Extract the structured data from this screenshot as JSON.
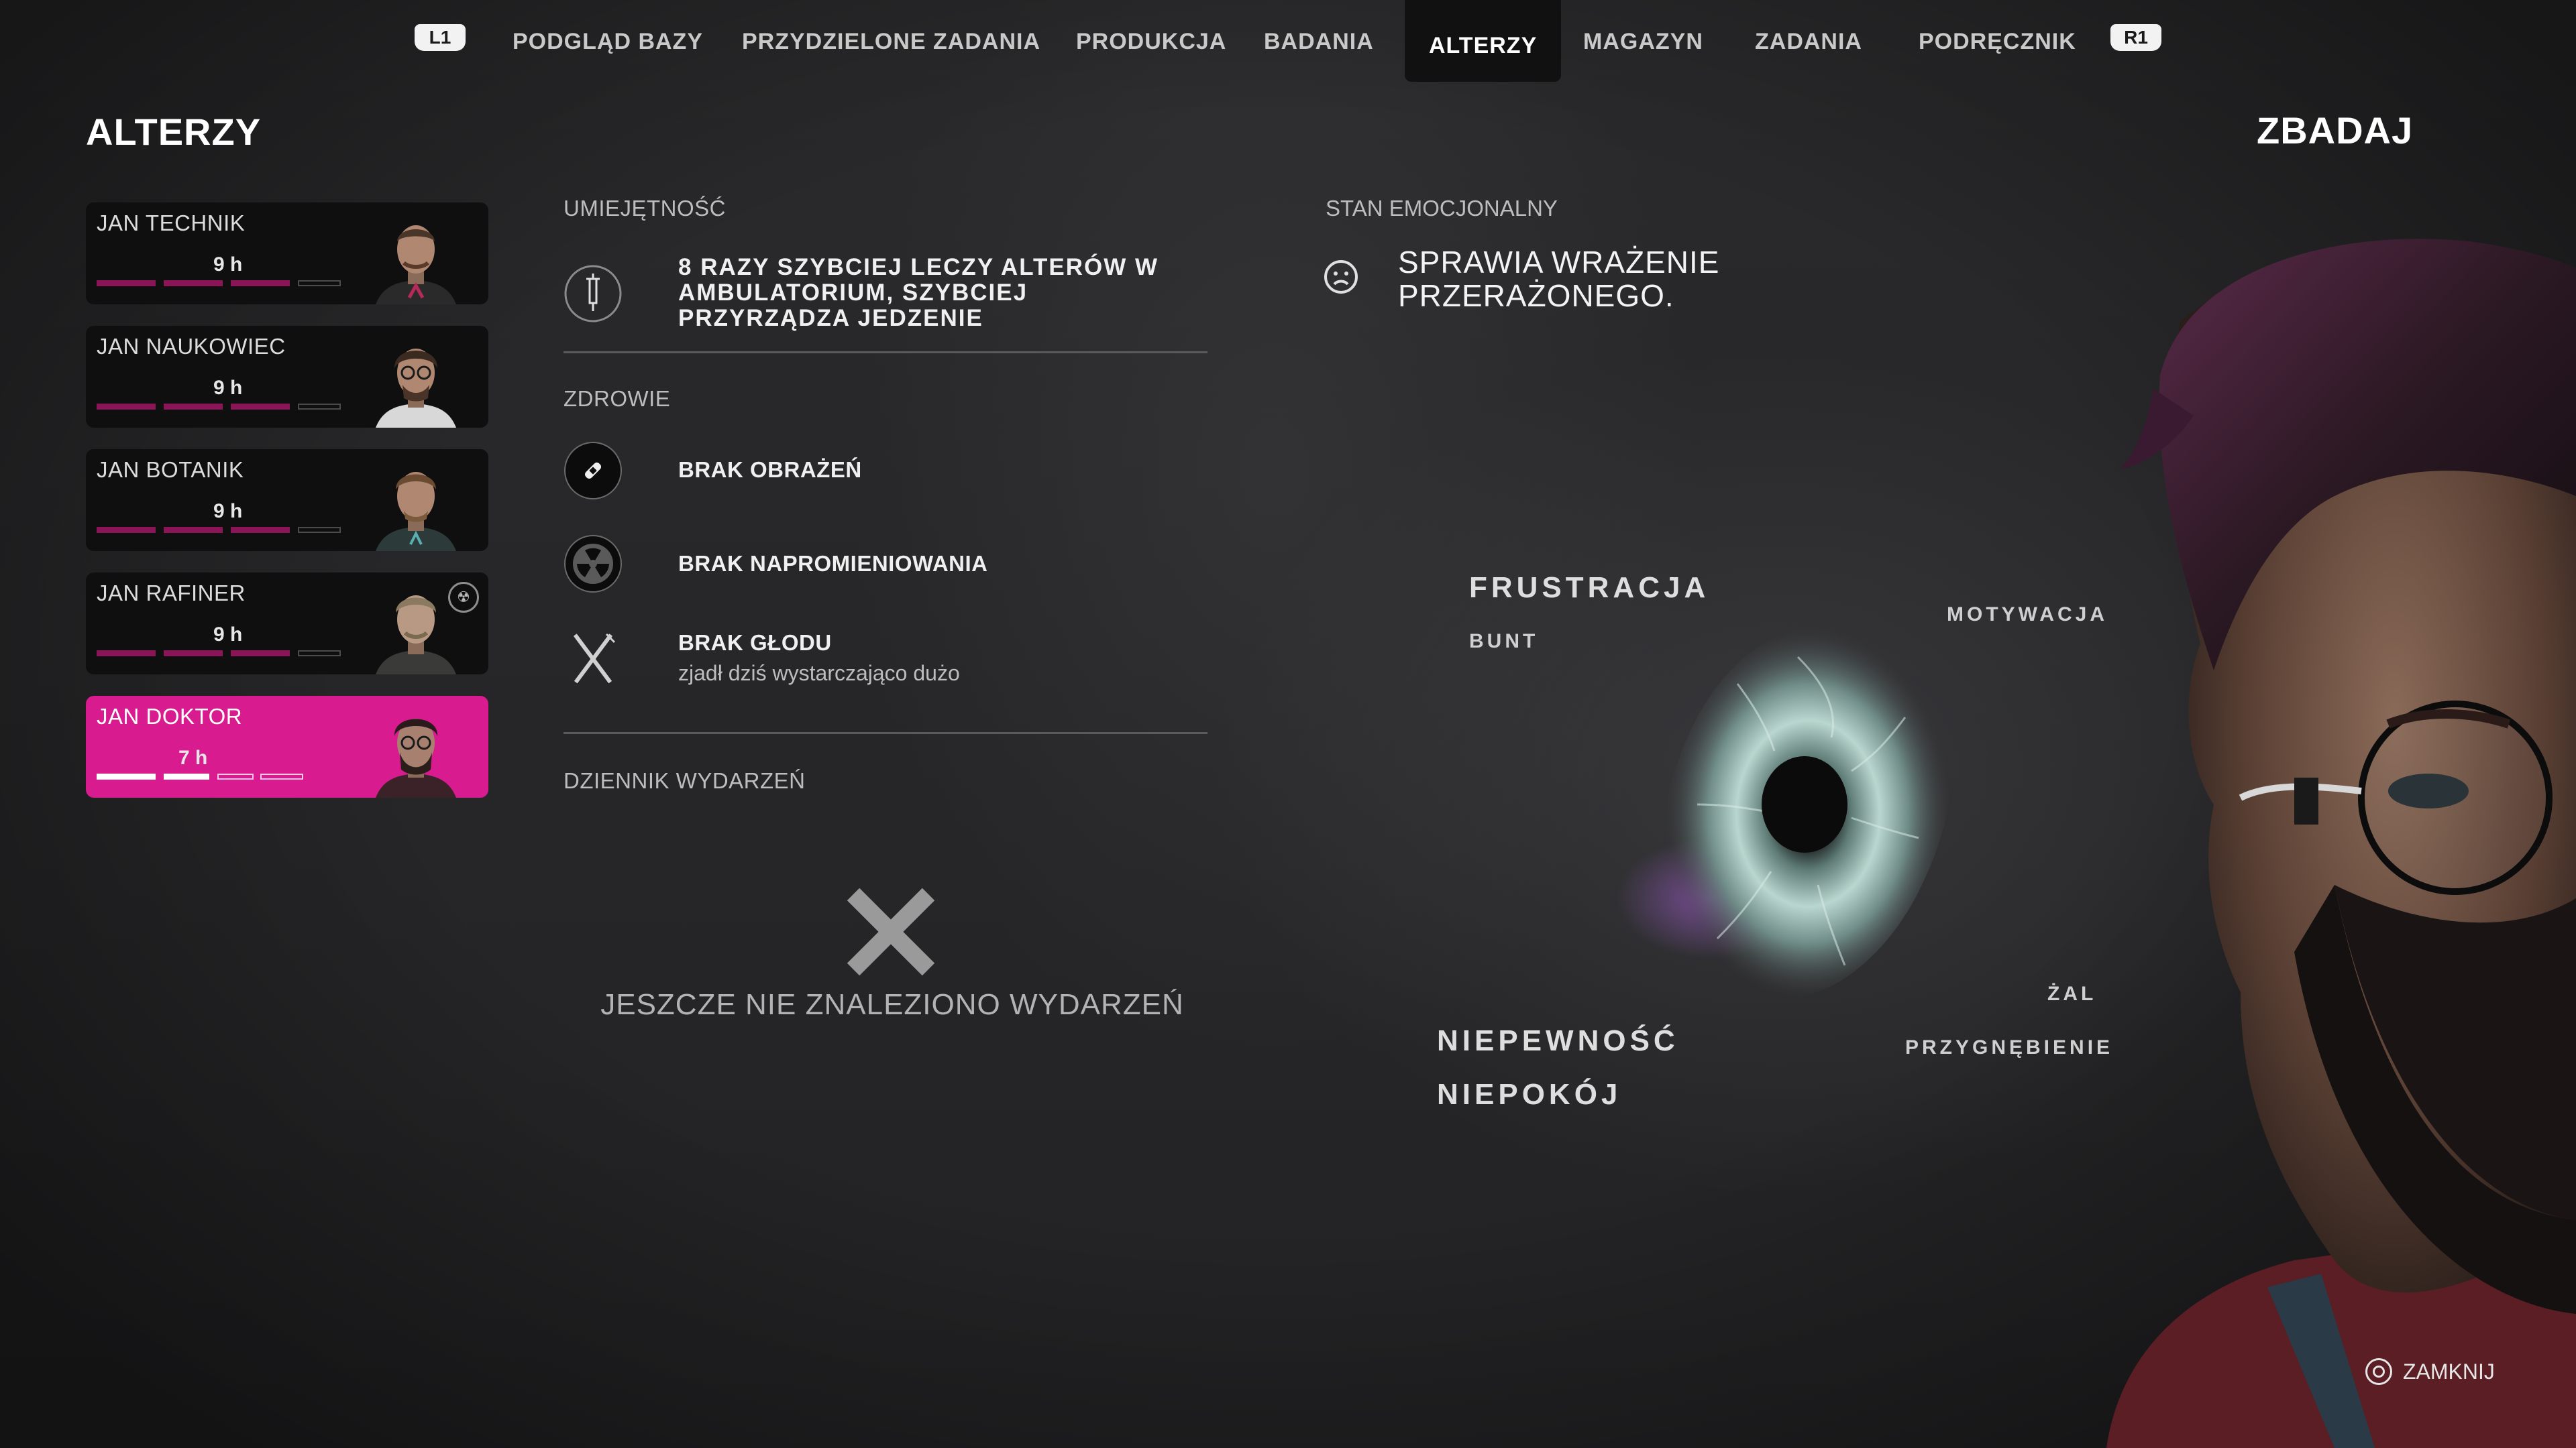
{
  "nav": {
    "left_shoulder": "L1",
    "right_shoulder": "R1",
    "tabs": [
      {
        "label": "PODGLĄD BAZY"
      },
      {
        "label": "PRZYDZIELONE ZADANIA"
      },
      {
        "label": "PRODUKCJA"
      },
      {
        "label": "BADANIA"
      },
      {
        "label": "ALTERZY",
        "active": true
      },
      {
        "label": "MAGAZYN"
      },
      {
        "label": "ZADANIA"
      },
      {
        "label": "PODRĘCZNIK"
      }
    ]
  },
  "page_title": "ALTERZY",
  "right_title": "ZBADAJ",
  "roster": [
    {
      "name": "JAN TECHNIK",
      "time": "9 h",
      "bars_filled": 3,
      "bars_total": 4
    },
    {
      "name": "JAN NAUKOWIEC",
      "time": "9 h",
      "bars_filled": 3,
      "bars_total": 4
    },
    {
      "name": "JAN BOTANIK",
      "time": "9 h",
      "bars_filled": 3,
      "bars_total": 4
    },
    {
      "name": "JAN RAFINER",
      "time": "9 h",
      "bars_filled": 3,
      "bars_total": 4,
      "status_icon": "radiation-icon"
    },
    {
      "name": "JAN DOKTOR",
      "time": "7 h",
      "bars_filled": 2,
      "bars_total": 4,
      "selected": true
    }
  ],
  "colors": {
    "accent": "#d81b8e",
    "bar_dark": "#8a1657"
  },
  "skill": {
    "heading": "UMIEJĘTNOŚĆ",
    "icon": "syringe-icon",
    "text": "8 RAZY SZYBCIEJ LECZY ALTERÓW W AMBULATORIUM, SZYBCIEJ PRZYRZĄDZA JEDZENIE"
  },
  "health": {
    "heading": "ZDROWIE",
    "items": [
      {
        "icon": "bandage-icon",
        "title": "BRAK OBRAŻEŃ"
      },
      {
        "icon": "radiation-icon",
        "title": "BRAK NAPROMIENIOWANIA"
      },
      {
        "icon": "fork-knife-icon",
        "title": "BRAK GŁODU",
        "subtitle": "zjadł dziś wystarczająco dużo"
      }
    ]
  },
  "event_log": {
    "heading": "DZIENNIK WYDARZEŃ",
    "empty_text": "JESZCZE NIE ZNALEZIONO WYDARZEŃ"
  },
  "emotional": {
    "heading": "STAN EMOCJONALNY",
    "icon": "sad-face-icon",
    "text": "SPRAWIA WRAŻENIE PRZERAŻONEGO.",
    "labels": {
      "frustration": "FRUSTRACJA",
      "rebellion": "BUNT",
      "motivation": "MOTYWACJA",
      "regret": "ŻAL",
      "depression": "PRZYGNĘBIENIE",
      "uncertainty": "NIEPEWNOŚĆ",
      "anxiety": "NIEPOKÓJ"
    }
  },
  "close_hint": {
    "icon": "circle-button-icon",
    "label": "ZAMKNIJ"
  }
}
